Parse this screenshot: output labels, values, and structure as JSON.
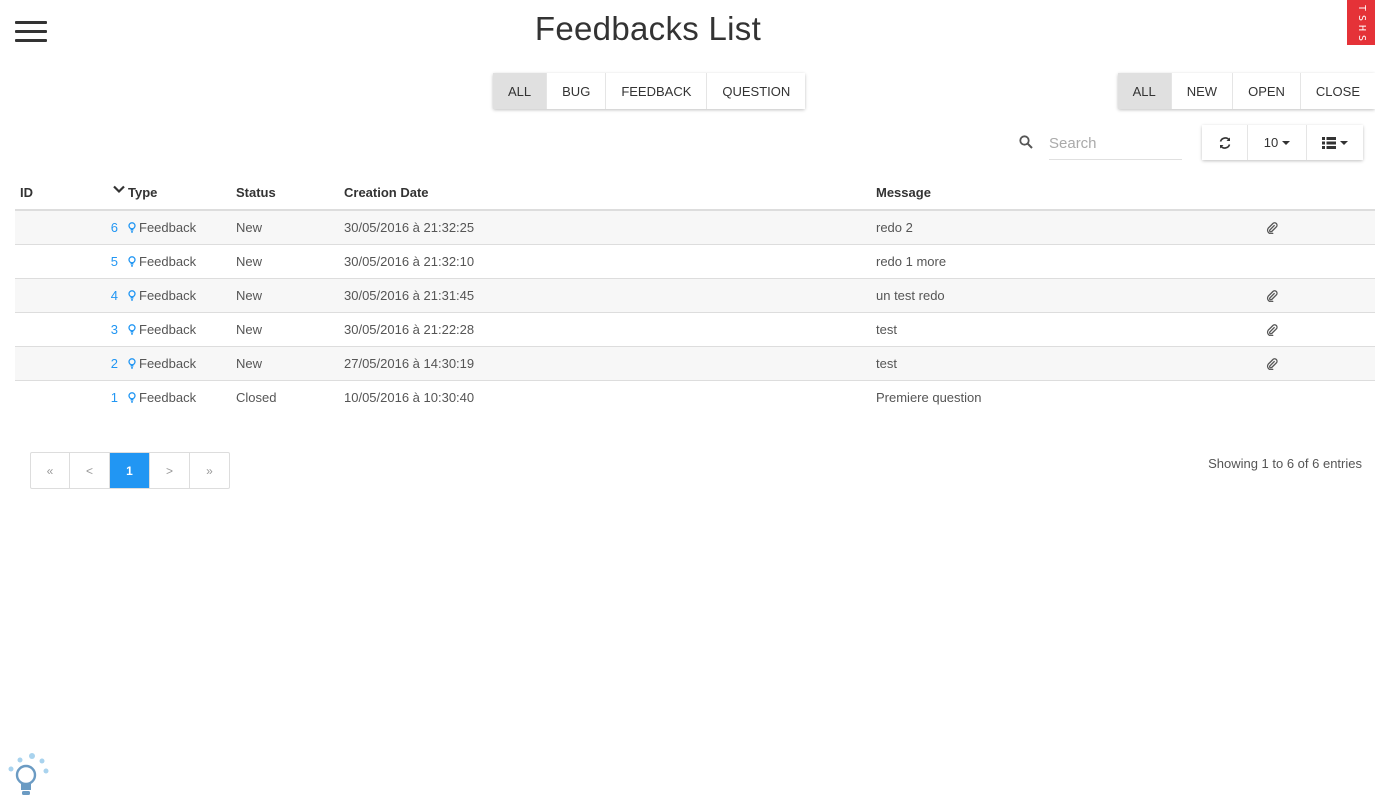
{
  "header": {
    "title": "Feedbacks List",
    "logo_text": "TSHS"
  },
  "type_filter": [
    {
      "label": "ALL",
      "active": true
    },
    {
      "label": "BUG",
      "active": false
    },
    {
      "label": "FEEDBACK",
      "active": false
    },
    {
      "label": "QUESTION",
      "active": false
    }
  ],
  "status_filter": [
    {
      "label": "ALL",
      "active": true
    },
    {
      "label": "NEW",
      "active": false
    },
    {
      "label": "OPEN",
      "active": false
    },
    {
      "label": "CLOSE",
      "active": false
    }
  ],
  "search": {
    "placeholder": "Search",
    "value": ""
  },
  "toolbar": {
    "page_size": "10"
  },
  "table": {
    "headers": {
      "id": "ID",
      "type": "Type",
      "status": "Status",
      "date": "Creation Date",
      "message": "Message"
    },
    "rows": [
      {
        "id": "6",
        "type": "Feedback",
        "status": "New",
        "date": "30/05/2016 à 21:32:25",
        "message": "redo 2",
        "attachment": true
      },
      {
        "id": "5",
        "type": "Feedback",
        "status": "New",
        "date": "30/05/2016 à 21:32:10",
        "message": "redo 1 more",
        "attachment": false
      },
      {
        "id": "4",
        "type": "Feedback",
        "status": "New",
        "date": "30/05/2016 à 21:31:45",
        "message": "un test redo",
        "attachment": true
      },
      {
        "id": "3",
        "type": "Feedback",
        "status": "New",
        "date": "30/05/2016 à 21:22:28",
        "message": "test",
        "attachment": true
      },
      {
        "id": "2",
        "type": "Feedback",
        "status": "New",
        "date": "27/05/2016 à 14:30:19",
        "message": "test",
        "attachment": true
      },
      {
        "id": "1",
        "type": "Feedback",
        "status": "Closed",
        "date": "10/05/2016 à 10:30:40",
        "message": "Premiere question",
        "attachment": false
      }
    ]
  },
  "pagination": {
    "first": "«",
    "prev": "<",
    "current": "1",
    "next": ">",
    "last": "»",
    "summary": "Showing 1 to 6 of 6 entries"
  },
  "colors": {
    "accent": "#2196f3",
    "logo": "#e53238",
    "active_btn": "#e0e0e0"
  }
}
